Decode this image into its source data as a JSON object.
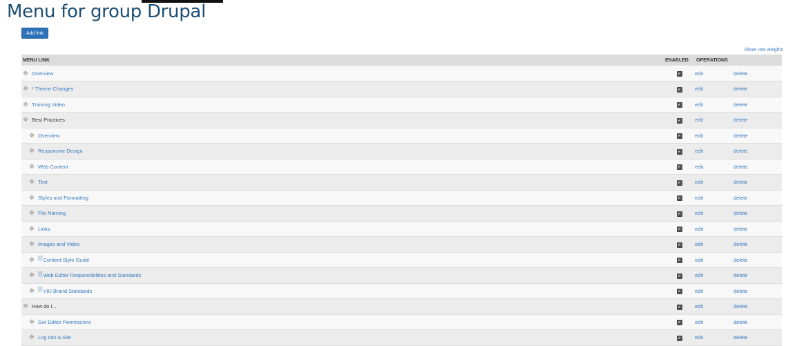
{
  "page": {
    "title": "Menu for group Drupal"
  },
  "toolbar": {
    "add_link": "Add link",
    "show_row_weights": "Show row weights"
  },
  "table": {
    "headers": {
      "menu_link": "MENU LINK",
      "enabled": "ENABLED",
      "operations": "OPERATIONS"
    },
    "rows": [
      {
        "label": "Overview",
        "indent": 0,
        "style": "link",
        "doc": false,
        "enabled": true,
        "edit": "edit",
        "delete": "delete"
      },
      {
        "label": "* Theme Changes",
        "indent": 0,
        "style": "link",
        "doc": false,
        "enabled": true,
        "edit": "edit",
        "delete": "delete"
      },
      {
        "label": "Training Video",
        "indent": 0,
        "style": "link",
        "doc": false,
        "enabled": true,
        "edit": "edit",
        "delete": "delete"
      },
      {
        "label": "Best Practices",
        "indent": 0,
        "style": "dark",
        "doc": false,
        "enabled": true,
        "edit": "edit",
        "delete": "delete"
      },
      {
        "label": "Overview",
        "indent": 1,
        "style": "link",
        "doc": false,
        "enabled": true,
        "edit": "edit",
        "delete": "delete"
      },
      {
        "label": "Responsive Design",
        "indent": 1,
        "style": "link",
        "doc": false,
        "enabled": true,
        "edit": "edit",
        "delete": "delete"
      },
      {
        "label": "Web Content",
        "indent": 1,
        "style": "link",
        "doc": false,
        "enabled": true,
        "edit": "edit",
        "delete": "delete"
      },
      {
        "label": "Text",
        "indent": 1,
        "style": "link",
        "doc": false,
        "enabled": true,
        "edit": "edit",
        "delete": "delete"
      },
      {
        "label": "Styles and Formatting",
        "indent": 1,
        "style": "link",
        "doc": false,
        "enabled": true,
        "edit": "edit",
        "delete": "delete"
      },
      {
        "label": "File Naming",
        "indent": 1,
        "style": "link",
        "doc": false,
        "enabled": true,
        "edit": "edit",
        "delete": "delete"
      },
      {
        "label": "Links",
        "indent": 1,
        "style": "link",
        "doc": false,
        "enabled": true,
        "edit": "edit",
        "delete": "delete"
      },
      {
        "label": "Images and Video",
        "indent": 1,
        "style": "link",
        "doc": false,
        "enabled": true,
        "edit": "edit",
        "delete": "delete"
      },
      {
        "label": "Content Style Guide",
        "indent": 1,
        "style": "link",
        "doc": true,
        "enabled": true,
        "edit": "edit",
        "delete": "delete"
      },
      {
        "label": "Web Editor Responsibilities and Standards",
        "indent": 1,
        "style": "link",
        "doc": true,
        "enabled": true,
        "edit": "edit",
        "delete": "delete"
      },
      {
        "label": "VIU Brand Standards",
        "indent": 1,
        "style": "link",
        "doc": true,
        "enabled": true,
        "edit": "edit",
        "delete": "delete"
      },
      {
        "label": "How do I...",
        "indent": 0,
        "style": "dark",
        "doc": false,
        "enabled": true,
        "edit": "edit",
        "delete": "delete"
      },
      {
        "label": "Get Editor Permissions",
        "indent": 1,
        "style": "link",
        "doc": false,
        "enabled": true,
        "edit": "edit",
        "delete": "delete"
      },
      {
        "label": "Log into a Site",
        "indent": 1,
        "style": "link",
        "doc": false,
        "enabled": true,
        "edit": "edit",
        "delete": "delete"
      }
    ]
  },
  "icons": {
    "drag": "drag-handle-icon",
    "doc": "document-icon",
    "checkbox": "checkbox-icon"
  },
  "colors": {
    "title": "#1d4e74",
    "accent": "#2b72b8",
    "link": "#3a7bbf"
  }
}
